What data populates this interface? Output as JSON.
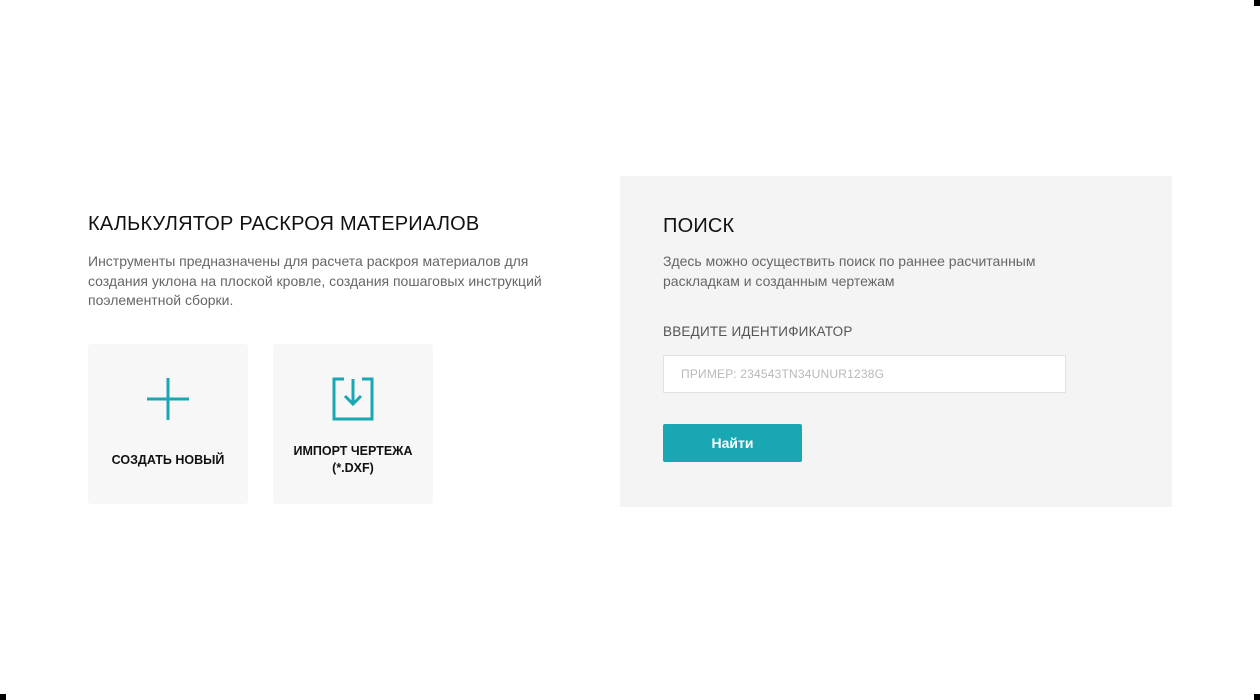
{
  "calculator": {
    "title": "КАЛЬКУЛЯТОР РАСКРОЯ МАТЕРИАЛОВ",
    "description": "Инструменты предназначены для расчета раскроя материалов для создания уклона на плоской кровле, создания пошаговых инструкций поэлементной сборки.",
    "cards": {
      "new": {
        "label": "СОЗДАТЬ НОВЫЙ",
        "icon": "plus-icon"
      },
      "import": {
        "label": "ИМПОРТ ЧЕРТЕЖА (*.DXF)",
        "icon": "import-download-icon"
      }
    }
  },
  "search": {
    "title": "ПОИСК",
    "description": "Здесь можно осуществить поиск по раннее расчитанным раскладкам и созданным чертежам",
    "field_label": "ВВЕДИТЕ ИДЕНТИФИКАТОР",
    "input_value": "",
    "input_placeholder": "ПРИМЕР: 234543TN34UNUR1238G",
    "button_label": "Найти"
  },
  "colors": {
    "accent": "#1aa7b4",
    "panel_bg": "#f4f4f4",
    "card_bg": "#f7f7f7"
  }
}
